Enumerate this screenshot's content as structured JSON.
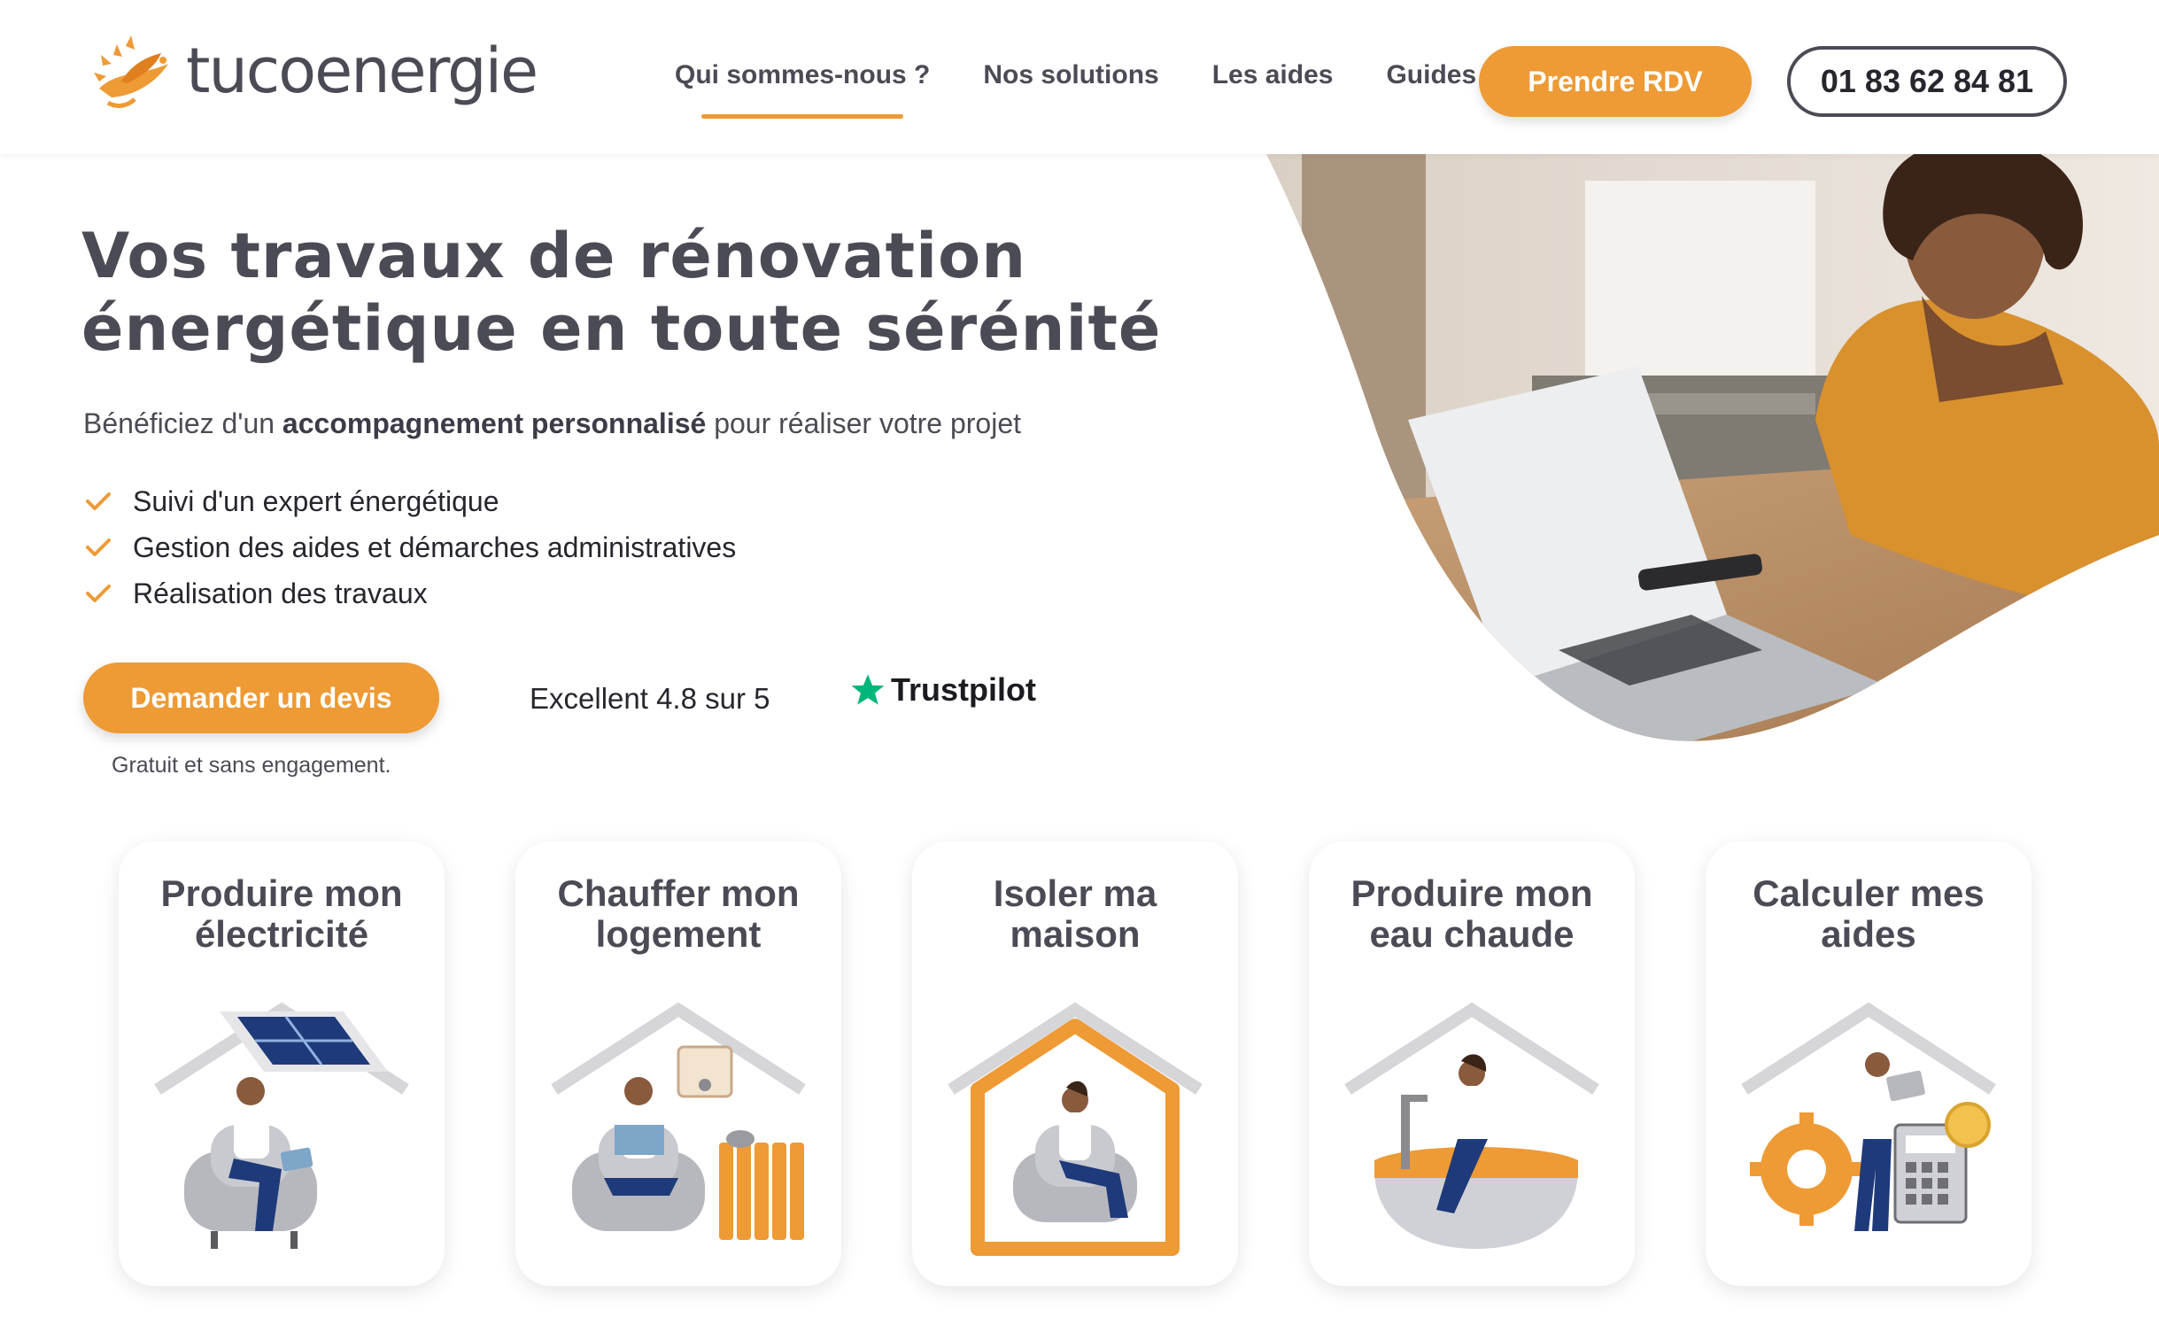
{
  "header": {
    "logo_text": "tucoenergie",
    "nav": [
      {
        "label": "Qui sommes-nous ?",
        "active": true
      },
      {
        "label": "Nos solutions",
        "active": false
      },
      {
        "label": "Les aides",
        "active": false
      },
      {
        "label": "Guides",
        "active": false
      }
    ],
    "cta_label": "Prendre RDV",
    "phone": "01 83 62 84 81"
  },
  "hero": {
    "title_line1": "Vos travaux de rénovation",
    "title_line2": "énergétique en toute sérénité",
    "subtitle_pre": "Bénéficiez d'un ",
    "subtitle_bold": "accompagnement personnalisé",
    "subtitle_post": " pour réaliser votre projet",
    "checks": [
      "Suivi d'un expert énergétique",
      "Gestion des aides et démarches administratives",
      "Réalisation des travaux"
    ],
    "cta_label": "Demander un devis",
    "cta_note": "Gratuit et sans engagement.",
    "rating_text": "Excellent 4.8 sur 5",
    "trustpilot_label": "Trustpilot"
  },
  "cards": [
    {
      "title": "Produire mon\nélectricité",
      "icon": "solar-panel-icon"
    },
    {
      "title": "Chauffer mon\nlogement",
      "icon": "radiator-icon"
    },
    {
      "title": "Isoler ma\nmaison",
      "icon": "insulated-house-icon"
    },
    {
      "title": "Produire mon\neau chaude",
      "icon": "bathtub-icon"
    },
    {
      "title": "Calculer mes\naides",
      "icon": "calculator-icon"
    }
  ],
  "colors": {
    "accent": "#ee9a35",
    "text": "#4b4b55",
    "trustpilot_green": "#00b67a",
    "navy": "#1f3a7a"
  }
}
